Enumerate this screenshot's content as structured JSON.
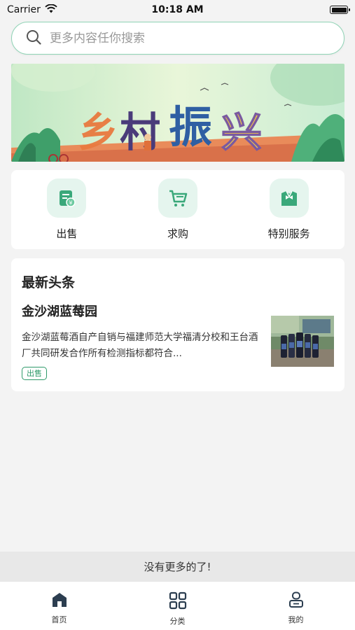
{
  "status_bar": {
    "carrier": "Carrier",
    "time": "10:18 AM"
  },
  "search": {
    "placeholder": "更多内容任你搜索"
  },
  "banner": {
    "alt_text": "乡村振兴"
  },
  "services": [
    {
      "label": "出售",
      "icon": "sell-icon"
    },
    {
      "label": "求购",
      "icon": "cart-icon"
    },
    {
      "label": "特别服务",
      "icon": "special-service-icon"
    }
  ],
  "news": {
    "section_title": "最新头条",
    "items": [
      {
        "title": "金沙湖蓝莓园",
        "description": "金沙湖蓝莓酒自产自销与福建师范大学福清分校和王台酒厂共同研发合作所有检测指标都符合...",
        "tag": "出售"
      }
    ]
  },
  "footer_notice": "没有更多的了!",
  "tabs": [
    {
      "label": "首页",
      "icon": "home-icon",
      "active": true
    },
    {
      "label": "分类",
      "icon": "category-icon",
      "active": false
    },
    {
      "label": "我的",
      "icon": "profile-icon",
      "active": false
    }
  ],
  "colors": {
    "accent": "#2e9a6a",
    "search_border": "#8fd3b5",
    "icon_bg": "#e5f5ee",
    "tab_icon": "#2c3e50"
  }
}
